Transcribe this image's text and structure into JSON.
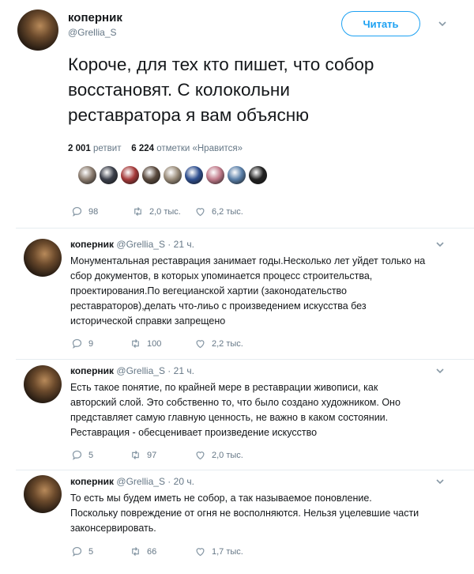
{
  "main_tweet": {
    "author_name": "коперник",
    "author_handle": "@Grellia_S",
    "follow_label": "Читать",
    "text_lines": [
      "Короче, для тех кто пишет, что собор",
      "восстановят. С колокольни",
      "реставратора я вам объясню"
    ],
    "retweets_count": "2 001",
    "retweets_label": "ретвит",
    "likes_count": "6 224",
    "likes_label": "отметки «Нравится»",
    "likers_count": 9,
    "actions": {
      "replies": "98",
      "retweets": "2,0 тыс.",
      "likes": "6,2 тыс."
    }
  },
  "replies": [
    {
      "author_name": "коперник",
      "author_handle": "@Grellia_S",
      "time": "21 ч.",
      "lines": [
        "Монументальная реставрация занимает годы.Несколько лет уйдет только на",
        "сбор документов, в которых упоминается процесс строительства,",
        "проектирования.По вегецианской хартии (законодательство",
        "реставраторов),делать что-лиьо с произведением искусства без",
        "исторической справки запрещено"
      ],
      "actions": {
        "replies": "9",
        "retweets": "100",
        "likes": "2,2 тыс."
      }
    },
    {
      "author_name": "коперник",
      "author_handle": "@Grellia_S",
      "time": "21 ч.",
      "lines": [
        "Есть такое понятие, по крайней мере в реставрации живописи, как",
        "авторский слой. Это собственно то, что было создано художником. Оно",
        "представляет самую главную ценность, не важно в каком состоянии.",
        "Реставрация - обесценивает произведение искусство"
      ],
      "actions": {
        "replies": "5",
        "retweets": "97",
        "likes": "2,0 тыс."
      }
    },
    {
      "author_name": "коперник",
      "author_handle": "@Grellia_S",
      "time": "20 ч.",
      "lines": [
        "То есть мы будем иметь не собор, а так называемое поновление.",
        "Поскольку повреждение от огня не восполняются. Нельзя уцелевшие части",
        "законсервировать."
      ],
      "actions": {
        "replies": "5",
        "retweets": "66",
        "likes": "1,7 тыс."
      }
    }
  ],
  "colors": {
    "accent": "#1da1f2",
    "muted": "#657786",
    "text": "#14171a",
    "divider": "#e6ecf0"
  },
  "icons": [
    "reply-icon",
    "retweet-icon",
    "heart-icon",
    "chevron-down-icon",
    "avatar"
  ]
}
